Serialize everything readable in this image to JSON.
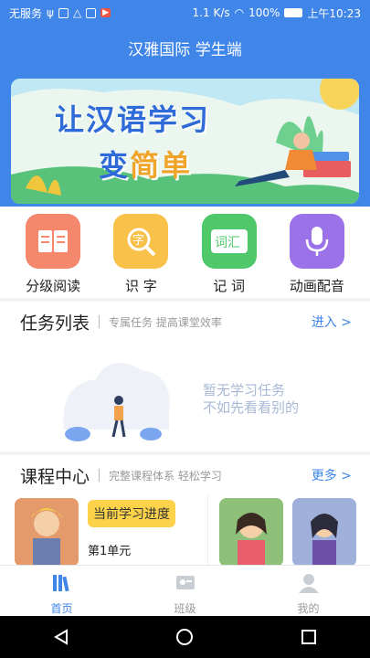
{
  "status_bar": {
    "carrier": "无服务",
    "speed": "1.1 K/s",
    "battery": "100%",
    "time": "上午10:23"
  },
  "app_title": "汉雅国际 学生端",
  "banner": {
    "line1": "让汉语学习",
    "line2_a": "变",
    "line2_b": "简单"
  },
  "features": [
    {
      "label": "分级阅读",
      "icon": "book-icon",
      "color": "#f4876c"
    },
    {
      "label": "识 字",
      "icon": "character-magnifier-icon",
      "color": "#f8c24a"
    },
    {
      "label": "记 词",
      "icon": "vocabulary-icon",
      "color": "#4fc86a"
    },
    {
      "label": "动画配音",
      "icon": "microphone-icon",
      "color": "#9b72e8"
    }
  ],
  "tasks": {
    "title": "任务列表",
    "subtitle": "专属任务 提高课堂效率",
    "more": "进入 >",
    "empty_line1": "暂无学习任务",
    "empty_line2": "不如先看看别的"
  },
  "courses": {
    "title": "课程中心",
    "subtitle": "完整课程体系 轻松学习",
    "more": "更多 >",
    "progress_label": "当前学习进度",
    "unit": "第1单元"
  },
  "tabbar": [
    {
      "label": "首页",
      "icon": "books-icon",
      "active": true
    },
    {
      "label": "班级",
      "icon": "class-icon",
      "active": false
    },
    {
      "label": "我的",
      "icon": "profile-icon",
      "active": false
    }
  ],
  "colors": {
    "primary": "#3f86e8",
    "tab_inactive": "#999999"
  }
}
